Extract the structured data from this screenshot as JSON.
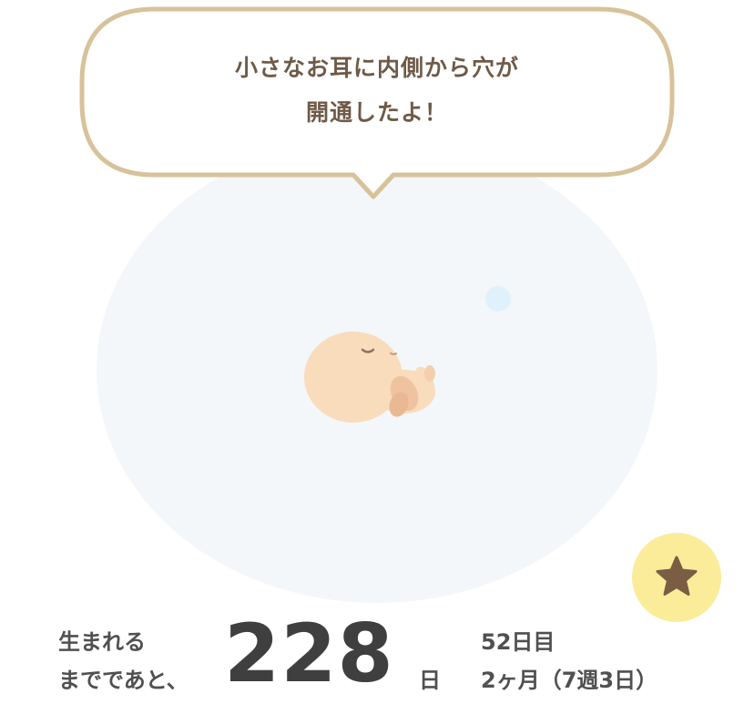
{
  "speech_bubble": {
    "line1": "小さなお耳に内側から穴が",
    "line2": "開通したよ！"
  },
  "favorite_button": {
    "icon": "star-icon"
  },
  "countdown": {
    "label_line1": "生まれる",
    "label_line2": "までであと、",
    "days_remaining": "228",
    "days_unit": "日"
  },
  "progress": {
    "day_count": "52日目",
    "month_week": "2ヶ月（7週3日）"
  },
  "colors": {
    "bubble_border": "#d7c29a",
    "text_brown": "#6e5a47",
    "womb_bg": "#f3f7f9",
    "fav_bg": "#fbec9a",
    "star": "#7a5d43"
  }
}
